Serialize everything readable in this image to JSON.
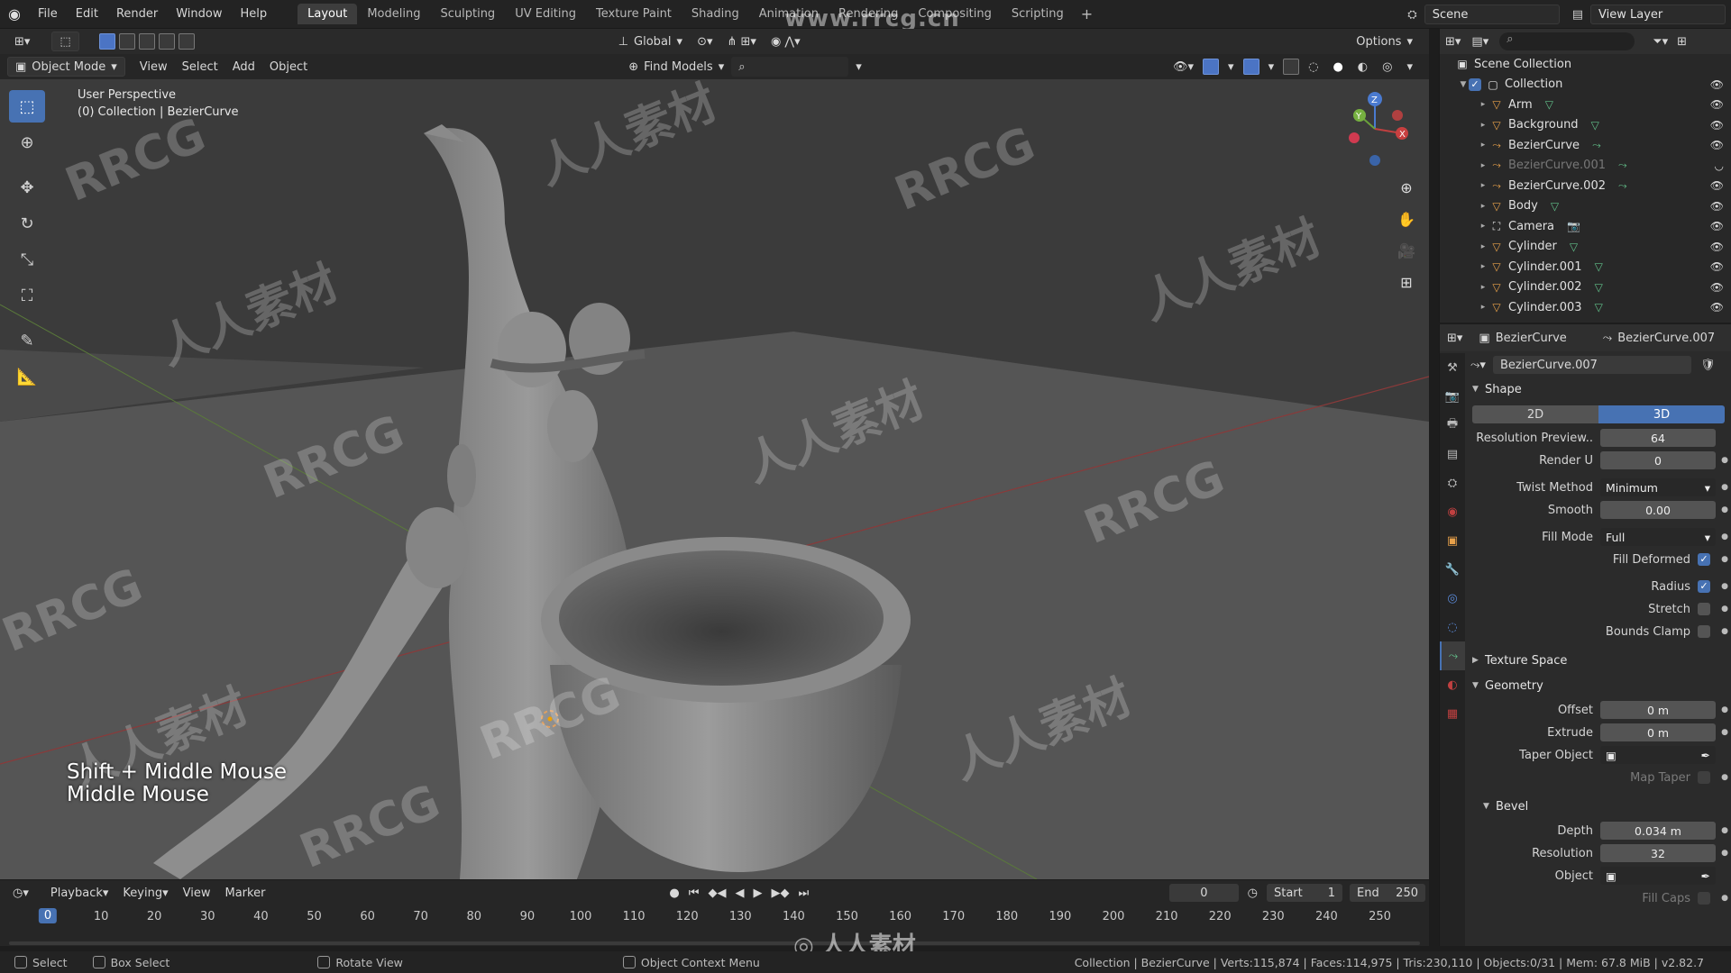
{
  "topbar": {
    "menus": [
      "File",
      "Edit",
      "Render",
      "Window",
      "Help"
    ],
    "workspaces": [
      "Layout",
      "Modeling",
      "Sculpting",
      "UV Editing",
      "Texture Paint",
      "Shading",
      "Animation",
      "Rendering",
      "Compositing",
      "Scripting"
    ],
    "active_workspace": "Layout",
    "scene": "Scene",
    "view_layer": "View Layer",
    "watermark": "www.rrcg.cn"
  },
  "viewport_header": {
    "orientation": "Global",
    "options": "Options",
    "mode": "Object Mode",
    "menus": [
      "View",
      "Select",
      "Add",
      "Object"
    ],
    "find_models": "Find Models"
  },
  "viewport": {
    "perspective": "User Perspective",
    "collection_info": "(0) Collection | BezierCurve",
    "hint_line1": "Shift + Middle Mouse",
    "hint_line2": "Middle Mouse",
    "watermark_en": "RRCG",
    "watermark_cn": "人人素材"
  },
  "gizmo": {
    "z": "Z",
    "y": "Y",
    "x": "X"
  },
  "outliner": {
    "root": "Scene Collection",
    "collection": "Collection",
    "items": [
      {
        "name": "Arm",
        "type": "mesh",
        "dim": false
      },
      {
        "name": "Background",
        "type": "mesh",
        "dim": false
      },
      {
        "name": "BezierCurve",
        "type": "curve",
        "dim": false
      },
      {
        "name": "BezierCurve.001",
        "type": "curve",
        "dim": true
      },
      {
        "name": "BezierCurve.002",
        "type": "curve",
        "dim": false
      },
      {
        "name": "Body",
        "type": "mesh",
        "dim": false
      },
      {
        "name": "Camera",
        "type": "camera",
        "dim": false
      },
      {
        "name": "Cylinder",
        "type": "mesh",
        "dim": false
      },
      {
        "name": "Cylinder.001",
        "type": "mesh",
        "dim": false
      },
      {
        "name": "Cylinder.002",
        "type": "mesh",
        "dim": false
      },
      {
        "name": "Cylinder.003",
        "type": "mesh",
        "dim": false
      }
    ]
  },
  "properties": {
    "object_name": "BezierCurve",
    "data_name": "BezierCurve.007",
    "datablock": "BezierCurve.007",
    "shape_section": "Shape",
    "dim_2d": "2D",
    "dim_3d": "3D",
    "resolution_preview_label": "Resolution Preview..",
    "resolution_preview": "64",
    "render_u_label": "Render U",
    "render_u": "0",
    "twist_method_label": "Twist Method",
    "twist_method": "Minimum",
    "smooth_label": "Smooth",
    "smooth": "0.00",
    "fill_mode_label": "Fill Mode",
    "fill_mode": "Full",
    "fill_deformed_label": "Fill Deformed",
    "radius_label": "Radius",
    "stretch_label": "Stretch",
    "bounds_clamp_label": "Bounds Clamp",
    "texture_space_section": "Texture Space",
    "geometry_section": "Geometry",
    "offset_label": "Offset",
    "offset": "0 m",
    "extrude_label": "Extrude",
    "extrude": "0 m",
    "taper_object_label": "Taper Object",
    "map_taper_label": "Map Taper",
    "bevel_section": "Bevel",
    "depth_label": "Depth",
    "depth": "0.034 m",
    "resolution_label": "Resolution",
    "resolution": "32",
    "object_label": "Object",
    "fill_caps_label": "Fill Caps"
  },
  "timeline": {
    "menus": [
      "Playback",
      "Keying",
      "View",
      "Marker"
    ],
    "current_frame": "0",
    "start_label": "Start",
    "start": "1",
    "end_label": "End",
    "end": "250",
    "ruler": [
      "0",
      "10",
      "20",
      "30",
      "40",
      "50",
      "60",
      "70",
      "80",
      "90",
      "100",
      "110",
      "120",
      "130",
      "140",
      "150",
      "160",
      "170",
      "180",
      "190",
      "200",
      "210",
      "220",
      "230",
      "240",
      "250"
    ],
    "watermark": "人人素材"
  },
  "statusbar": {
    "select": "Select",
    "box_select": "Box Select",
    "rotate_view": "Rotate View",
    "context_menu": "Object Context Menu",
    "stats": "Collection | BezierCurve | Verts:115,874 | Faces:114,975 | Tris:230,110 | Objects:0/31 | Mem: 67.8 MiB | v2.82.7"
  }
}
